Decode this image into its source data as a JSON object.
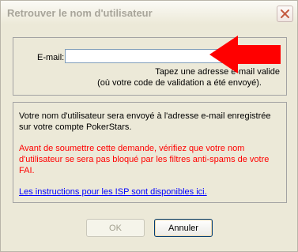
{
  "window": {
    "title": "Retrouver le nom d'utilisateur"
  },
  "icons": {
    "close": "close-x-icon",
    "arrow": "red-arrow-pointer"
  },
  "form": {
    "email_label": "E-mail:",
    "email_value": "",
    "hint_line1": "Tapez une adresse e-mail valide",
    "hint_line2": "(où votre code de validation a été envoyé)."
  },
  "info": {
    "text": "Votre nom d'utilisateur sera envoyé à l'adresse e-mail enregistrée sur votre compte PokerStars.",
    "warning": "Avant de soumettre cette demande, vérifiez que votre nom d'utilisateur se sera pas bloqué par les filtres anti-spams de votre FAI.",
    "link": "Les instructions pour les ISP sont disponibles ici."
  },
  "buttons": {
    "ok": "OK",
    "cancel": "Annuler"
  },
  "colors": {
    "warning": "#ff0000",
    "link": "#0000ff",
    "arrow": "#ff0000"
  }
}
